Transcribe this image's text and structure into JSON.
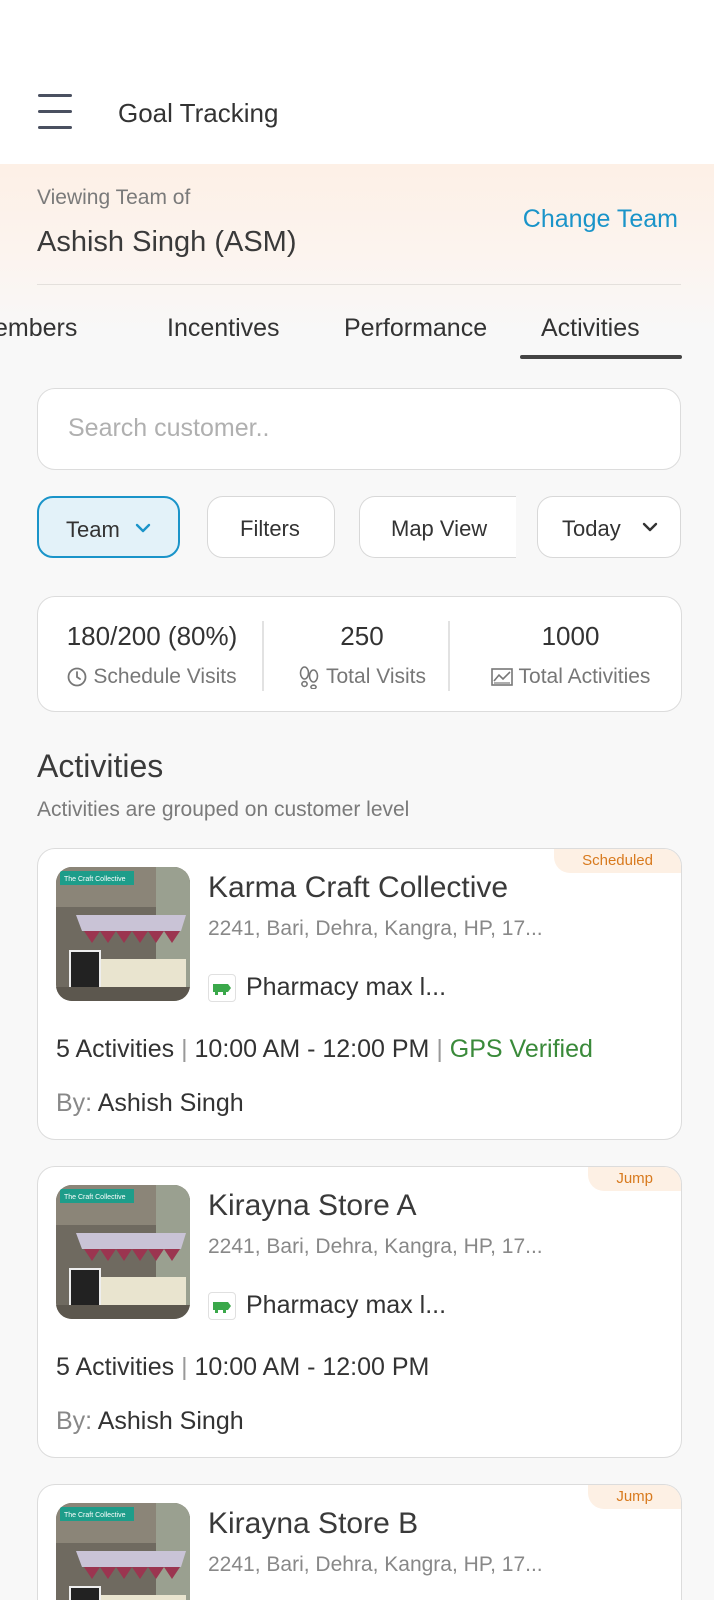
{
  "header": {
    "title": "Goal Tracking"
  },
  "team": {
    "viewing_label": "Viewing Team of",
    "name": "Ashish Singh (ASM)",
    "change_label": "Change Team"
  },
  "tabs": [
    {
      "label": "Members",
      "display": "embers"
    },
    {
      "label": "Incentives"
    },
    {
      "label": "Performance"
    },
    {
      "label": "Activities",
      "active": true
    }
  ],
  "search": {
    "placeholder": "Search customer.."
  },
  "filters": {
    "team_label": "Team",
    "filters_label": "Filters",
    "map_label": "Map View",
    "date_label": "Today"
  },
  "stats": {
    "scheduled": {
      "value": "180/200 (80%)",
      "label": "Schedule Visits",
      "icon": "clock-icon"
    },
    "visits": {
      "value": "250",
      "label": "Total Visits",
      "icon": "footsteps-icon"
    },
    "activities": {
      "value": "1000",
      "label": "Total Activities",
      "icon": "chart-icon"
    }
  },
  "section": {
    "title": "Activities",
    "subtitle": "Activities are grouped on customer level"
  },
  "cards": [
    {
      "badge": "Scheduled",
      "name": "Karma Craft Collective",
      "address": "2241, Bari, Dehra, Kangra, HP, 17...",
      "type": "Pharmacy max l...",
      "activities": "5 Activities",
      "time": "10:00 AM - 12:00 PM",
      "gps": "GPS Verified",
      "by_label": "By:",
      "by": "Ashish Singh"
    },
    {
      "badge": "Jump",
      "name": "Kirayna Store A",
      "address": "2241, Bari, Dehra, Kangra, HP, 17...",
      "type": "Pharmacy max l...",
      "activities": "5 Activities",
      "time": "10:00 AM - 12:00 PM",
      "by_label": "By:",
      "by": "Ashish Singh"
    },
    {
      "badge": "Jump",
      "name": "Kirayna Store B",
      "address": "2241, Bari, Dehra, Kangra, HP, 17..."
    }
  ],
  "thumb_sign": "The Craft Collective",
  "colors": {
    "accent": "#1a94c9",
    "badge_text": "#d87a1e",
    "gps_green": "#3a8a3a",
    "team_bar": "#fdf0e6"
  }
}
